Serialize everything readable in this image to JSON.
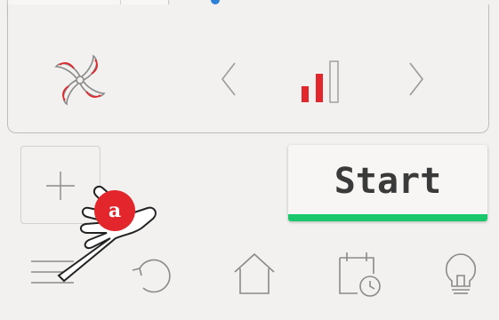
{
  "fan_panel": {
    "speed_level": 2,
    "speed_max": 3,
    "prev_icon": "chevron-left-icon",
    "next_icon": "chevron-right-icon",
    "fan_icon": "fan-icon",
    "accent_color": "#e2262c"
  },
  "controls": {
    "add_icon": "plus-icon",
    "start_label": "Start",
    "start_accent": "#1bc76b"
  },
  "bottom_nav": {
    "items": [
      "menu-icon",
      "undo-icon",
      "home-icon",
      "timer-icon",
      "lightbulb-icon"
    ]
  },
  "overlay": {
    "hand_icon": "pointing-hand-icon",
    "badge_label": "a",
    "badge_color": "#e2262c"
  }
}
